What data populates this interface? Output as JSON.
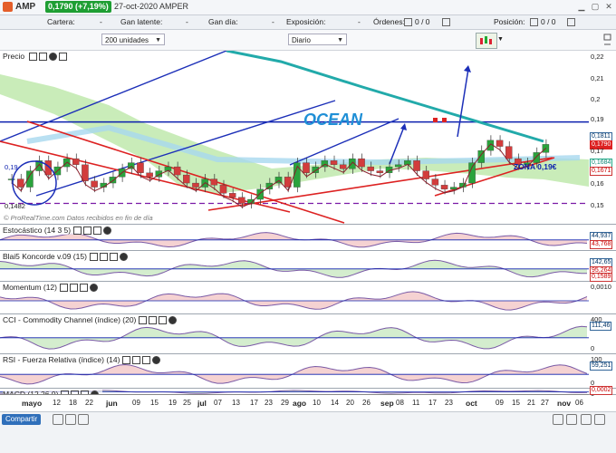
{
  "title": {
    "symbol": "AMP",
    "price": "0,1790 (+7,19%)",
    "date": "27-oct-2020 AMPER"
  },
  "info_bar": [
    {
      "label": "Cartera:",
      "value": "-"
    },
    {
      "label": "Gan latente:",
      "value": "-"
    },
    {
      "label": "Gan día:",
      "value": "-"
    },
    {
      "label": "Exposición:",
      "value": "-"
    },
    {
      "label": "Órdenes:",
      "value": "0 / 0"
    },
    {
      "label": "Posición:",
      "value": "0 / 0"
    }
  ],
  "controls": {
    "units": "200 unidades",
    "period": "Diario"
  },
  "chart": {
    "price_label": "Precio",
    "watermark": "© ProRealTime.com Datos recibidos en fin de día",
    "annotations": {
      "ocean": "OCEAN",
      "zona": "ZONA 0,19€",
      "level": "0,19",
      "low": "0,1482"
    },
    "y_ticks": [
      "0,22",
      "0,21",
      "0,2",
      "0,19",
      "0,17",
      "0,16",
      "0,15"
    ],
    "price_tags": [
      "0,1811",
      "0,1790",
      "0,1684",
      "0,1671"
    ]
  },
  "indicators": [
    {
      "name": "Estocástico (14 3 5)",
      "ticks": [
        "",
        ""
      ],
      "tags": [
        "44,937",
        "43,768"
      ]
    },
    {
      "name": "Blai5 Koncorde v.09 (15)",
      "ticks": [
        "",
        ""
      ],
      "tags": [
        "142,65",
        "95,264",
        "0,1589"
      ]
    },
    {
      "name": "Momentum (12)",
      "ticks": [
        "0,0010"
      ],
      "tags": []
    },
    {
      "name": "CCI - Commodity Channel (índice) (20)",
      "ticks": [
        "400",
        "0"
      ],
      "tags": [
        "111,46"
      ]
    },
    {
      "name": "RSI - Fuerza Relativa (índice) (14)",
      "ticks": [
        "100",
        "0"
      ],
      "tags": [
        "59,251"
      ]
    },
    {
      "name": "MACD (12 26 9)",
      "ticks": [
        "0"
      ],
      "tags": [
        "0,0013",
        "0,0002"
      ]
    }
  ],
  "x_axis": [
    {
      "label": "mayo",
      "month": true
    },
    {
      "label": "12"
    },
    {
      "label": "18"
    },
    {
      "label": "22"
    },
    {
      "label": "jun",
      "month": true
    },
    {
      "label": "09"
    },
    {
      "label": "15"
    },
    {
      "label": "19"
    },
    {
      "label": "25"
    },
    {
      "label": "jul",
      "month": true
    },
    {
      "label": "07"
    },
    {
      "label": "13"
    },
    {
      "label": "17"
    },
    {
      "label": "23"
    },
    {
      "label": "29"
    },
    {
      "label": "ago",
      "month": true
    },
    {
      "label": "10"
    },
    {
      "label": "14"
    },
    {
      "label": "20"
    },
    {
      "label": "26"
    },
    {
      "label": "sep",
      "month": true
    },
    {
      "label": "08"
    },
    {
      "label": "11"
    },
    {
      "label": "17"
    },
    {
      "label": "23"
    },
    {
      "label": "oct",
      "month": true
    },
    {
      "label": "09"
    },
    {
      "label": "15"
    },
    {
      "label": "21"
    },
    {
      "label": "27"
    },
    {
      "label": "nov",
      "month": true
    },
    {
      "label": "06"
    }
  ],
  "footer": {
    "share": "Compartir"
  },
  "chart_data": {
    "type": "candlestick",
    "title": "",
    "ylim": [
      0.14,
      0.225
    ],
    "price_series": [
      0.162,
      0.158,
      0.166,
      0.171,
      0.164,
      0.168,
      0.172,
      0.169,
      0.161,
      0.158,
      0.16,
      0.163,
      0.167,
      0.17,
      0.165,
      0.163,
      0.166,
      0.168,
      0.164,
      0.16,
      0.158,
      0.162,
      0.159,
      0.155,
      0.153,
      0.15,
      0.152,
      0.157,
      0.16,
      0.163,
      0.158,
      0.17,
      0.165,
      0.168,
      0.171,
      0.169,
      0.167,
      0.172,
      0.168,
      0.166,
      0.165,
      0.168,
      0.169,
      0.171,
      0.166,
      0.162,
      0.159,
      0.157,
      0.158,
      0.16,
      0.17,
      0.176,
      0.181,
      0.178,
      0.172,
      0.169,
      0.17,
      0.175,
      0.179
    ],
    "levels": [
      {
        "name": "ZONA 0,19€",
        "value": 0.19
      },
      {
        "name": "0,15",
        "value": 0.15
      }
    ],
    "last_close": 0.179
  }
}
